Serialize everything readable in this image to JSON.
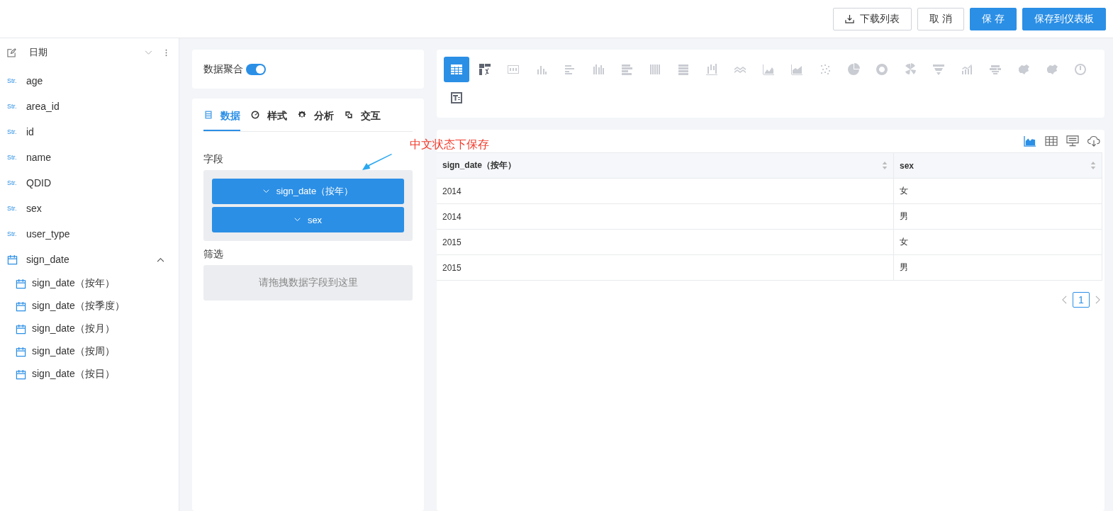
{
  "toolbar": {
    "buttons": [
      {
        "label": "下载列表",
        "kind": "download",
        "primary": false
      },
      {
        "label": "取 消",
        "kind": "plain",
        "primary": false
      },
      {
        "label": "保 存",
        "kind": "plain",
        "primary": true
      },
      {
        "label": "保存到仪表板",
        "kind": "plain",
        "primary": true
      }
    ]
  },
  "sidebar": {
    "title": "日期",
    "fields": [
      {
        "type_label": "Str.",
        "name": "age"
      },
      {
        "type_label": "Str.",
        "name": "area_id"
      },
      {
        "type_label": "Str.",
        "name": "id"
      },
      {
        "type_label": "Str.",
        "name": "name"
      },
      {
        "type_label": "Str.",
        "name": "QDID"
      },
      {
        "type_label": "Str.",
        "name": "sex"
      },
      {
        "type_label": "Str.",
        "name": "user_type"
      }
    ],
    "date_group": {
      "name": "sign_date",
      "expanded": true,
      "children": [
        {
          "name": "sign_date（按年）"
        },
        {
          "name": "sign_date（按季度）"
        },
        {
          "name": "sign_date（按月）"
        },
        {
          "name": "sign_date（按周）"
        },
        {
          "name": "sign_date（按日）"
        }
      ]
    }
  },
  "aggregation": {
    "label": "数据聚合",
    "on": true
  },
  "config_tabs": [
    {
      "label": "数据",
      "kind": "data",
      "selected": true
    },
    {
      "label": "样式",
      "kind": "style",
      "selected": false
    },
    {
      "label": "分析",
      "kind": "analysis",
      "selected": false
    },
    {
      "label": "交互",
      "kind": "interaction",
      "selected": false
    }
  ],
  "fields_section": {
    "label": "字段",
    "chips": [
      "sign_date（按年）",
      "sex"
    ]
  },
  "filter_section": {
    "label": "筛选",
    "placeholder": "请拖拽数据字段到这里"
  },
  "annotation": {
    "text": "中文状态下保存"
  },
  "chart_types": [
    {
      "kind": "table",
      "selected": true,
      "disabled": false
    },
    {
      "kind": "pivot",
      "selected": false,
      "disabled": false
    },
    {
      "kind": "number",
      "selected": false,
      "disabled": true
    },
    {
      "kind": "bar",
      "selected": false,
      "disabled": true
    },
    {
      "kind": "hbar",
      "selected": false,
      "disabled": true
    },
    {
      "kind": "group-bar",
      "selected": false,
      "disabled": true
    },
    {
      "kind": "stack-hbar",
      "selected": false,
      "disabled": true
    },
    {
      "kind": "stack-bar",
      "selected": false,
      "disabled": true
    },
    {
      "kind": "percent-hbar",
      "selected": false,
      "disabled": true
    },
    {
      "kind": "waterfall",
      "selected": false,
      "disabled": true
    },
    {
      "kind": "wave",
      "selected": false,
      "disabled": true
    },
    {
      "kind": "area",
      "selected": false,
      "disabled": true
    },
    {
      "kind": "stack-area",
      "selected": false,
      "disabled": true
    },
    {
      "kind": "scatter",
      "selected": false,
      "disabled": true
    },
    {
      "kind": "pie",
      "selected": false,
      "disabled": true
    },
    {
      "kind": "donut",
      "selected": false,
      "disabled": true
    },
    {
      "kind": "rose",
      "selected": false,
      "disabled": true
    },
    {
      "kind": "funnel",
      "selected": false,
      "disabled": true
    },
    {
      "kind": "combo",
      "selected": false,
      "disabled": true
    },
    {
      "kind": "word-cloud",
      "selected": false,
      "disabled": true
    },
    {
      "kind": "map",
      "selected": false,
      "disabled": true
    },
    {
      "kind": "map",
      "selected": false,
      "disabled": true
    },
    {
      "kind": "gauge",
      "selected": false,
      "disabled": true
    },
    {
      "kind": "text",
      "selected": false,
      "disabled": false
    }
  ],
  "view_buttons": [
    {
      "kind": "chart",
      "selected": true
    },
    {
      "kind": "table",
      "selected": false
    },
    {
      "kind": "sql",
      "selected": false
    },
    {
      "kind": "download",
      "selected": false
    }
  ],
  "table": {
    "columns": [
      "sign_date（按年）",
      "sex"
    ],
    "rows": [
      [
        "2014",
        "女"
      ],
      [
        "2014",
        "男"
      ],
      [
        "2015",
        "女"
      ],
      [
        "2015",
        "男"
      ]
    ]
  },
  "pagination": {
    "pages": [
      {
        "label": "1",
        "selected": true
      }
    ]
  }
}
